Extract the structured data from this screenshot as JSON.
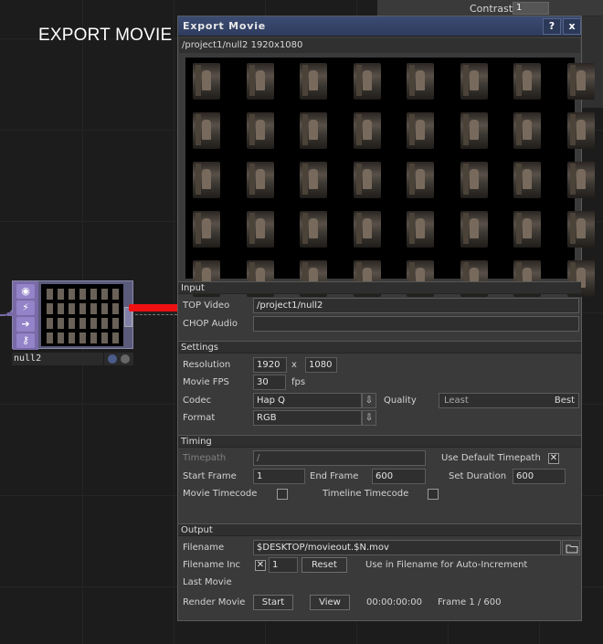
{
  "background": {
    "title": "EXPORT MOVIE",
    "contrast_label": "Contrast",
    "contrast_value": "1",
    "node_name": "null2"
  },
  "dialog": {
    "title": "Export Movie",
    "help": "?",
    "close": "x",
    "path": "/project1/null2 1920x1080",
    "input": {
      "header": "Input",
      "top_video_label": "TOP Video",
      "top_video_value": "/project1/null2",
      "chop_audio_label": "CHOP Audio",
      "chop_audio_value": ""
    },
    "settings": {
      "header": "Settings",
      "resolution_label": "Resolution",
      "res_w": "1920",
      "res_x": "x",
      "res_h": "1080",
      "fps_label": "Movie FPS",
      "fps_value": "30",
      "fps_unit": "fps",
      "codec_label": "Codec",
      "codec_value": "Hap Q",
      "quality_label": "Quality",
      "quality_least": "Least",
      "quality_best": "Best",
      "format_label": "Format",
      "format_value": "RGB"
    },
    "timing": {
      "header": "Timing",
      "timepath_label": "Timepath",
      "timepath_value": "/",
      "use_default_label": "Use Default Timepath",
      "use_default_checked": "✕",
      "start_label": "Start Frame",
      "start_value": "1",
      "end_label": "End Frame",
      "end_value": "600",
      "duration_label": "Set Duration",
      "duration_value": "600",
      "movie_tc_label": "Movie Timecode",
      "timeline_tc_label": "Timeline Timecode"
    },
    "output": {
      "header": "Output",
      "filename_label": "Filename",
      "filename_value": "$DESKTOP/movieout.$N.mov",
      "inc_label": "Filename Inc",
      "inc_checked": "✕",
      "inc_value": "1",
      "reset_label": "Reset",
      "inc_hint": "Use  in Filename for Auto-Increment",
      "last_movie_label": "Last Movie",
      "render_label": "Render Movie",
      "start_label": "Start",
      "view_label": "View",
      "timecode": "00:00:00:00",
      "frame_label": "Frame  1 / 600"
    }
  },
  "colors": {
    "titlebar": "#3b4c73",
    "panel": "#3a3a3a",
    "field": "#2f2f2f",
    "arrow": "#ee1111",
    "node": "#7a6aa8"
  }
}
